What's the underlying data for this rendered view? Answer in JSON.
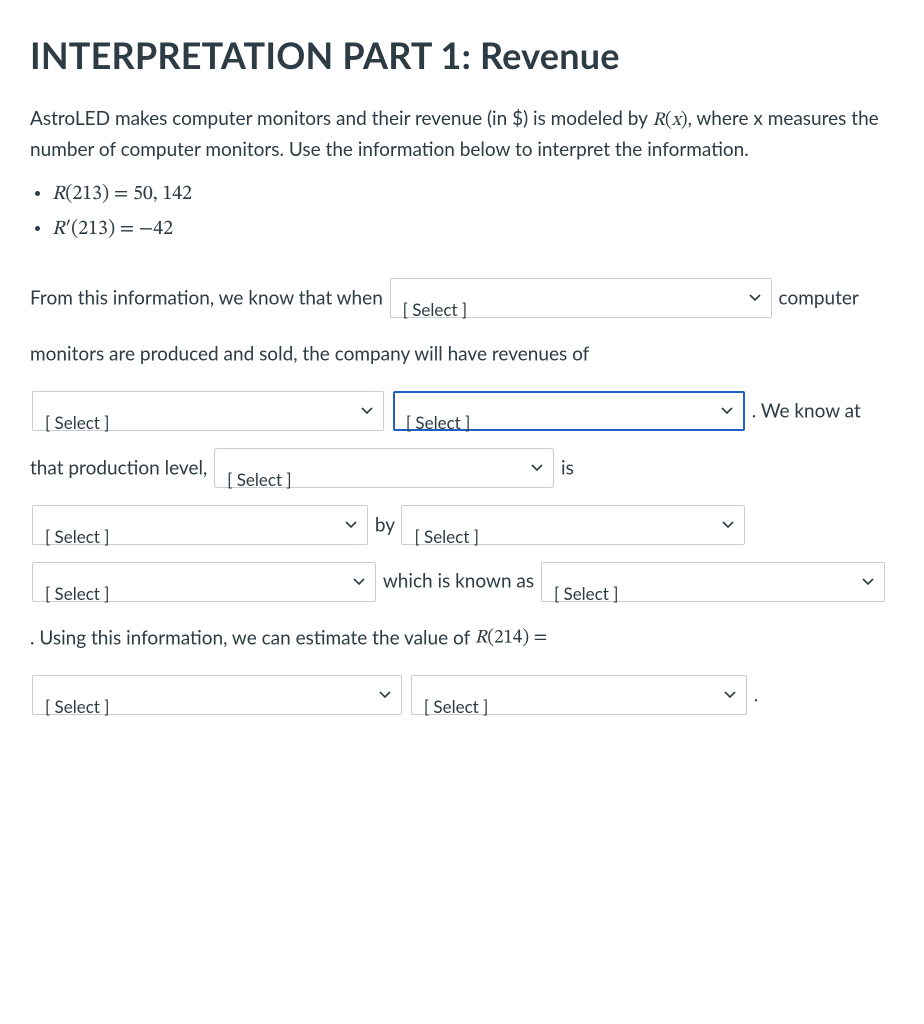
{
  "heading": "INTERPRETATION PART 1: Revenue",
  "intro": {
    "s1a": "AstroLED makes computer monitors and their revenue (in $) is modeled by ",
    "s1b": ", where x measures the number of computer monitors. Use the information below to interpret the information."
  },
  "symbols": {
    "R": "R",
    "x": "x",
    "of": "(",
    "cl": ")",
    "eq": " = ",
    "prime": "′"
  },
  "given": {
    "a_lhs_arg": "213",
    "a_rhs": "50, 142",
    "b_lhs_arg": "213",
    "b_rhs": "−42"
  },
  "select_placeholder": "[ Select ]",
  "flow": {
    "t1": "From this information, we know that when ",
    "t2": "computer monitors are produced and sold, the company will have revenues of ",
    "t3": " . We know at that production level, ",
    "t4": " is ",
    "t5": " by ",
    "t6": " which is known as ",
    "t7": " . Using this information, we can estimate the value of ",
    "eq_lhs_arg": "214",
    "t8": " ."
  }
}
